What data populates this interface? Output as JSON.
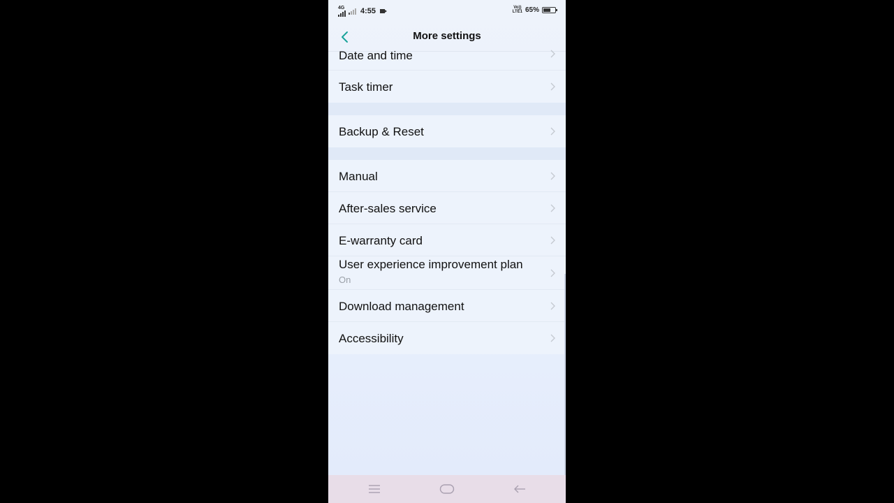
{
  "status_bar": {
    "network_type": "4G",
    "time": "4:55",
    "volte_line1": "Vo))",
    "volte_line2": "LTE1",
    "battery_percent": "65%",
    "battery_level": 0.65
  },
  "header": {
    "title": "More settings",
    "back_icon": "chevron-left-icon",
    "accent_color": "#1aa39a"
  },
  "settings_list": {
    "group1": [
      {
        "label": "Date and time"
      },
      {
        "label": "Task timer"
      }
    ],
    "group2": [
      {
        "label": "Backup & Reset"
      }
    ],
    "group3": [
      {
        "label": "Manual"
      },
      {
        "label": "After-sales service"
      },
      {
        "label": "E-warranty card"
      },
      {
        "label": "User experience improvement plan",
        "subtitle": "On"
      },
      {
        "label": "Download management"
      },
      {
        "label": "Accessibility"
      }
    ]
  },
  "nav_bar": {
    "menu_icon": "menu-icon",
    "home_icon": "home-icon",
    "back_icon": "back-arrow-icon"
  }
}
